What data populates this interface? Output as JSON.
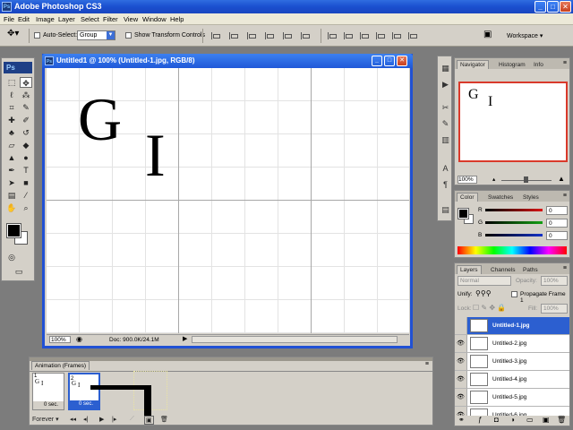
{
  "app": {
    "title": "Adobe Photoshop CS3",
    "logo": "Ps",
    "window_buttons": [
      "_",
      "□",
      "✕"
    ]
  },
  "menu": [
    "File",
    "Edit",
    "Image",
    "Layer",
    "Select",
    "Filter",
    "View",
    "Window",
    "Help"
  ],
  "options_bar": {
    "auto_select_label": "Auto-Select:",
    "auto_select_value": "Group",
    "show_transform_label": "Show Transform Controls",
    "workspace_label": "Workspace ▾"
  },
  "document": {
    "title": "Untitled1 @ 100% (Untitled-1.jpg, RGB/8)",
    "zoom": "100%",
    "doc_size": "Doc: 900.0K/24.1M",
    "letters": [
      "G",
      "I"
    ]
  },
  "navigator": {
    "tabs": [
      "Navigator",
      "Histogram",
      "Info"
    ],
    "zoom": "100%",
    "preview_letters": [
      "G",
      "I"
    ]
  },
  "color": {
    "tabs": [
      "Color",
      "Swatches",
      "Styles"
    ],
    "channels": [
      {
        "label": "R",
        "value": "0",
        "color": "#d81414"
      },
      {
        "label": "G",
        "value": "0",
        "color": "#14a014"
      },
      {
        "label": "B",
        "value": "0",
        "color": "#1432c8"
      }
    ]
  },
  "layers": {
    "tabs": [
      "Layers",
      "Channels",
      "Paths"
    ],
    "blend_mode": "Normal",
    "opacity_label": "Opacity:",
    "opacity_value": "100%",
    "unify_label": "Unify:",
    "propagate_label": "Propagate Frame 1",
    "lock_label": "Lock:",
    "fill_label": "Fill:",
    "fill_value": "100%",
    "items": [
      {
        "name": "Untitled-1.jpg",
        "selected": true
      },
      {
        "name": "Untitled-2.jpg",
        "selected": false
      },
      {
        "name": "Untitled-3.jpg",
        "selected": false
      },
      {
        "name": "Untitled-4.jpg",
        "selected": false
      },
      {
        "name": "Untitled-5.jpg",
        "selected": false
      },
      {
        "name": "Untitled-6.jpg",
        "selected": false
      }
    ]
  },
  "animation": {
    "title": "Animation (Frames)",
    "frames": [
      {
        "num": "1",
        "delay": "0 sec.",
        "selected": false
      },
      {
        "num": "2",
        "delay": "0 sec.",
        "selected": true
      }
    ],
    "loop": "Forever"
  },
  "colors": {
    "xp_blue": "#2151d4",
    "panel_gray": "#d4d0c8",
    "selection_blue": "#2c5fd0"
  }
}
